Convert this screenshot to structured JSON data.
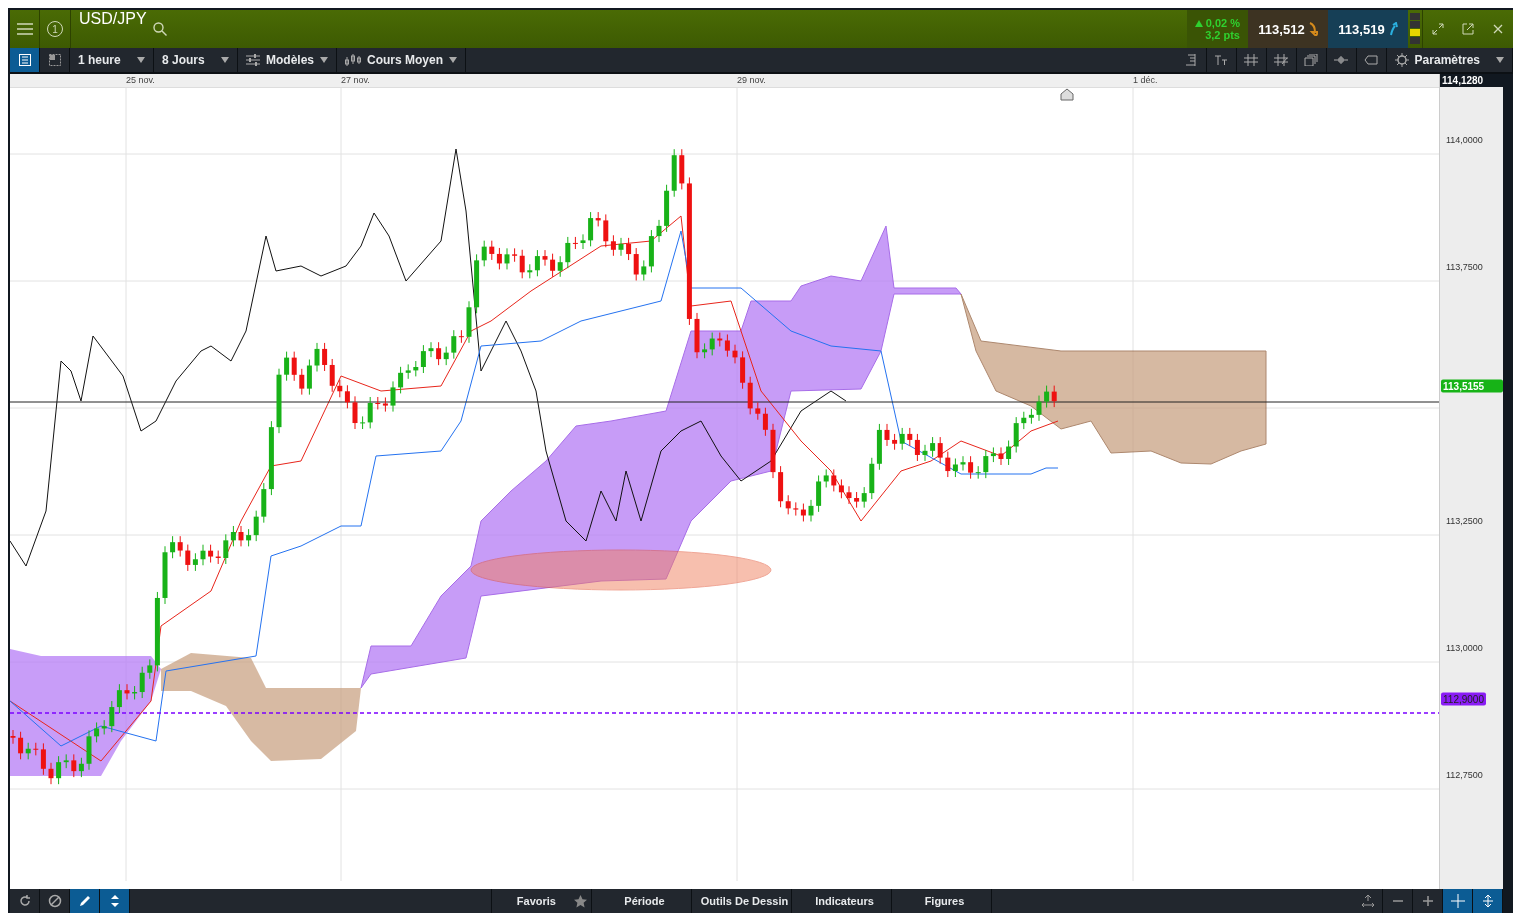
{
  "header": {
    "count": "1",
    "title": "USD/JPY",
    "change_percent": "0,02 %",
    "change_points": "3,2 pts",
    "bid": "113,512",
    "ask": "113,519"
  },
  "toolbar": {
    "views": [
      {
        "kind": "list",
        "selected": true
      },
      {
        "kind": "grid",
        "selected": false
      }
    ],
    "dropdowns": [
      {
        "kind": "plain",
        "label": "1 heure"
      },
      {
        "kind": "plain",
        "label": "8 Jours"
      },
      {
        "kind": "models",
        "label": "Modèles"
      },
      {
        "kind": "candles",
        "label": "Cours Moyen"
      }
    ],
    "settings": "Paramètres"
  },
  "dates": [
    {
      "label": "25 nov."
    },
    {
      "label": "27 nov."
    },
    {
      "label": "29 nov."
    },
    {
      "label": "1 déc."
    }
  ],
  "price_axis": {
    "ticks": [
      "114,0000",
      "113,7500",
      "113,2500",
      "113,0000",
      "112,7500"
    ],
    "high": "114,1280",
    "last": "113,5155",
    "alert": "112,9000"
  },
  "bottom_bar": {
    "left_tools": [
      {
        "kind": "refresh",
        "selected": false
      },
      {
        "kind": "block",
        "selected": false
      },
      {
        "kind": "pencil",
        "selected": true
      },
      {
        "kind": "updown",
        "selected": true
      }
    ],
    "tabs": [
      {
        "label": "Favoris",
        "starred": true
      },
      {
        "label": "Période",
        "starred": false
      },
      {
        "label": "Outils De Dessin",
        "starred": false
      },
      {
        "label": "Indicateurs",
        "starred": false
      },
      {
        "label": "Figures",
        "starred": false
      }
    ],
    "right_tools": [
      {
        "kind": "fit",
        "selected": false
      },
      {
        "kind": "zoom-out",
        "selected": false
      },
      {
        "kind": "zoom-in",
        "selected": false
      },
      {
        "kind": "crosshair",
        "selected": true
      },
      {
        "kind": "scale",
        "selected": true
      }
    ]
  }
}
